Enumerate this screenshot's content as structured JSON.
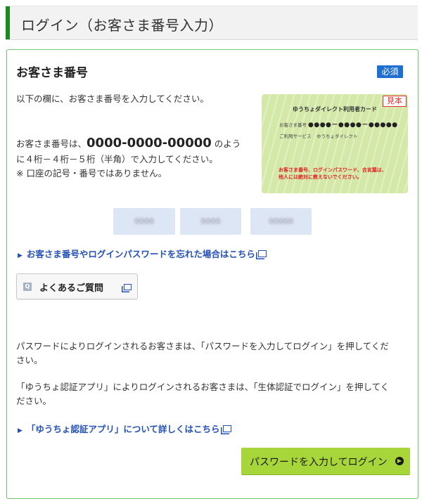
{
  "header": {
    "title": "ログイン（お客さま番号入力）"
  },
  "section": {
    "title": "お客さま番号",
    "required_badge": "必須",
    "instruction": "以下の欄に、お客さま番号を入力してください。",
    "format_prefix": "お客さま番号は、",
    "format_example": "0000-0000-00000",
    "format_suffix": " のよう",
    "format_line2": "に４桁－４桁－５桁（半角）で入力してください。",
    "note": "※ 口座の記号・番号ではありません。"
  },
  "card": {
    "sample": "見本",
    "title": "ゆうちょダイレクト利用者カード",
    "number_label": "お客さま番号",
    "number_value": "●●●●－●●●●－●●●●●",
    "service_label": "ご利用サービス",
    "service_value": "ゆうちょダイレクト",
    "warning_line1": "お客さま番号、ログインパスワード、合言葉は、",
    "warning_line2": "他人には絶対に教えないでください。"
  },
  "inputs": {
    "field1_placeholder": "0000",
    "field2_placeholder": "0000",
    "field3_placeholder": "00000"
  },
  "links": {
    "forgot": "お客さま番号やログインパスワードを忘れた場合はこちら",
    "app_info": "「ゆうちょ認証アプリ」について詳しくはこちら"
  },
  "faq_button": {
    "label": "よくあるご質問"
  },
  "paragraphs": {
    "password_line1": "パスワードによりログインされるお客さまは、「パスワードを入力してログイン」を押してくだ",
    "password_line2": "さい。",
    "app_line1": "「ゆうちょ認証アプリ」によりログインされるお客さまは、「生体認証でログイン」を押してく",
    "app_line2": "ださい。"
  },
  "login_button": {
    "label": "パスワードを入力してログイン"
  },
  "colors": {
    "accent_green": "#1a8a20",
    "button_green": "#a7d63a",
    "badge_blue": "#1f6fd1",
    "link_blue": "#2450b8"
  }
}
